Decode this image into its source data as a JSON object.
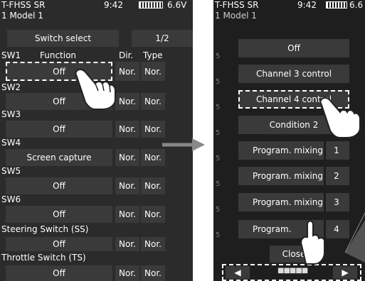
{
  "left": {
    "header": {
      "model_name": "T-FHSS SR",
      "time": "9:42",
      "voltage": "6.6V",
      "model_line": "1   Model 1"
    },
    "title": "Switch select",
    "page": "1/2",
    "columns": {
      "switch": "SW1",
      "function": "Function",
      "dir": "Dir.",
      "type": "Type"
    },
    "rows": [
      {
        "label": "",
        "function": "Off",
        "dir": "Nor.",
        "type": "Nor."
      },
      {
        "label": "SW2",
        "function": "Off",
        "dir": "Nor.",
        "type": "Nor."
      },
      {
        "label": "SW3",
        "function": "Off",
        "dir": "Nor.",
        "type": "Nor."
      },
      {
        "label": "SW4",
        "function": "Screen capture",
        "dir": "Nor.",
        "type": "Nor."
      },
      {
        "label": "SW5",
        "function": "Off",
        "dir": "Nor.",
        "type": "Nor."
      },
      {
        "label": "SW6",
        "function": "Off",
        "dir": "Nor.",
        "type": "Nor."
      },
      {
        "label": "Steering Switch (SS)",
        "function": "Off",
        "dir": "Nor.",
        "type": "Nor."
      },
      {
        "label": "Throttle Switch (TS)",
        "function": "Off",
        "dir": "Nor.",
        "type": "Nor."
      }
    ]
  },
  "arrow": "→",
  "right": {
    "header": {
      "model_name": "T-FHSS SR",
      "time": "9:42",
      "voltage": "6.6",
      "model_line": "1   Model 1"
    },
    "options": [
      {
        "label": "Off",
        "num": ""
      },
      {
        "label": "Channel 3 control",
        "num": ""
      },
      {
        "label": "Channel 4 control",
        "num": ""
      },
      {
        "label": "Condition 2",
        "num": ""
      },
      {
        "label": "Program. mixing",
        "num": "1"
      },
      {
        "label": "Program. mixing",
        "num": "2"
      },
      {
        "label": "Program. mixing",
        "num": "3"
      },
      {
        "label": "Program.",
        "num": "4"
      }
    ],
    "close_label": "Close",
    "prev": "◀",
    "next": "▶",
    "dots": "■■■■■",
    "side_marks": [
      "5",
      "5",
      "5",
      "5",
      "5",
      "5",
      "5",
      "5"
    ]
  },
  "colors": {
    "screen_bg": "#2b2b2b",
    "button_bg": "#3a3a3a",
    "arrow": "#888888",
    "hand_fill": "#ffffff"
  }
}
